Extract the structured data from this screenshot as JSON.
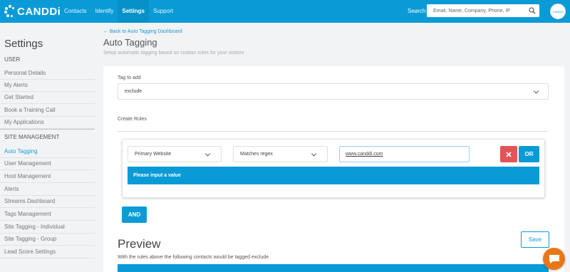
{
  "header": {
    "logo_text": "CANDDi",
    "nav": [
      {
        "label": "Contacts"
      },
      {
        "label": "Identify"
      },
      {
        "label": "Settings"
      },
      {
        "label": "Support"
      }
    ],
    "search_label": "Search",
    "search_placeholder": "Email, Name, Company, Phone, IP",
    "avatar_text": "CANDDi"
  },
  "sidebar": {
    "title": "Settings",
    "sections": [
      {
        "title": "USER",
        "items": [
          {
            "label": "Personal Details"
          },
          {
            "label": "My Alerts"
          },
          {
            "label": "Get Started"
          },
          {
            "label": "Book a Training Call"
          },
          {
            "label": "My Applications"
          }
        ]
      },
      {
        "title": "SITE MANAGEMENT",
        "items": [
          {
            "label": "Auto Tagging"
          },
          {
            "label": "User Management"
          },
          {
            "label": "Host Management"
          },
          {
            "label": "Alerts"
          },
          {
            "label": "Streams Dashboard"
          },
          {
            "label": "Tags Management"
          },
          {
            "label": "Site Tagging - Individual"
          },
          {
            "label": "Site Tagging - Group"
          },
          {
            "label": "Lead Score Settings"
          }
        ]
      }
    ]
  },
  "main": {
    "back_link": "Back to Auto Tagging Dashboard",
    "title": "Auto Tagging",
    "subtitle": "Setup automatic tagging based on custom rules for your visitors",
    "tag_label": "Tag to add",
    "tag_value": "exclude",
    "create_rules_label": "Create Rules",
    "rule": {
      "source": "Primary Website",
      "operator": "Matches regex",
      "value": "www.canddi.com",
      "or_label": "OR",
      "alert": "Please input a value"
    },
    "and_label": "AND",
    "preview_title": "Preview",
    "preview_text": "With the rules above the following contacts would be tagged exclude",
    "save_label": "Save"
  },
  "colors": {
    "brand": "#0a9bd7",
    "danger": "#e35458",
    "chat": "#e8771a"
  }
}
